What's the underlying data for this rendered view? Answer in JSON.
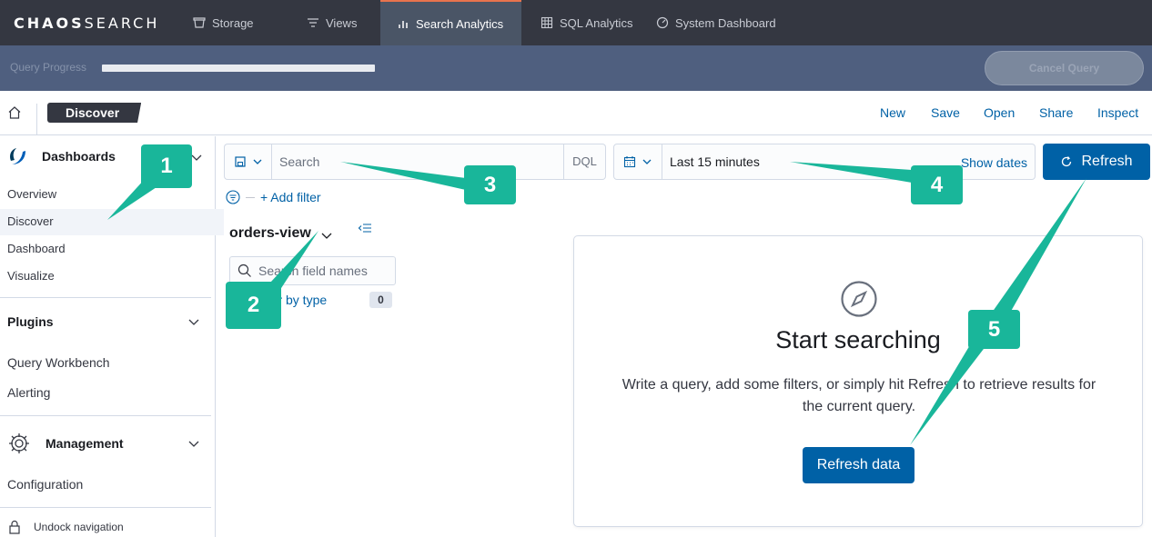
{
  "brand": {
    "logo_bold": "CHAOS",
    "logo_light": "SEARCH"
  },
  "nav": {
    "tabs": [
      {
        "label": "Storage",
        "icon": "storage-icon",
        "active": false
      },
      {
        "label": "Views",
        "icon": "filter-lines-icon",
        "active": false
      },
      {
        "label": "Search Analytics",
        "icon": "bar-chart-icon",
        "active": true
      },
      {
        "label": "SQL Analytics",
        "icon": "table-grid-icon",
        "active": false
      },
      {
        "label": "System Dashboard",
        "icon": "gauge-icon",
        "active": false
      }
    ]
  },
  "progress": {
    "label": "Query Progress",
    "value": 1.0,
    "cancel_label": "Cancel Query",
    "cancel_enabled": false
  },
  "header": {
    "breadcrumb": "Discover",
    "actions": [
      "New",
      "Save",
      "Open",
      "Share",
      "Inspect"
    ]
  },
  "sidebar": {
    "dashboards_label": "Dashboards",
    "dashboard_items": [
      "Overview",
      "Discover",
      "Dashboard",
      "Visualize"
    ],
    "selected_item": "Discover",
    "plugins_label": "Plugins",
    "plugin_items": [
      "Query Workbench",
      "Alerting"
    ],
    "management_label": "Management",
    "management_items": [
      "Configuration"
    ],
    "undock_label": "Undock navigation"
  },
  "query_bar": {
    "search_placeholder": "Search",
    "language": "DQL",
    "time_range": "Last 15 minutes",
    "show_dates_label": "Show dates",
    "refresh_label": "Refresh",
    "add_filter_label": "+ Add filter"
  },
  "field_list": {
    "index_pattern": "orders-view",
    "search_placeholder": "Search field names",
    "filter_by_type_label": "Filter by type",
    "filter_count": "0"
  },
  "empty_state": {
    "title": "Start searching",
    "body": "Write a query, add some filters, or simply hit Refresh to retrieve results for the current query.",
    "button_label": "Refresh data"
  },
  "callouts": [
    "1",
    "2",
    "3",
    "4",
    "5"
  ],
  "colors": {
    "topbar": "#343741",
    "progress_strip": "#4f5f7f",
    "primary": "#0061a6",
    "callout": "#19b69a",
    "active_tab_accent": "#e8734d"
  }
}
